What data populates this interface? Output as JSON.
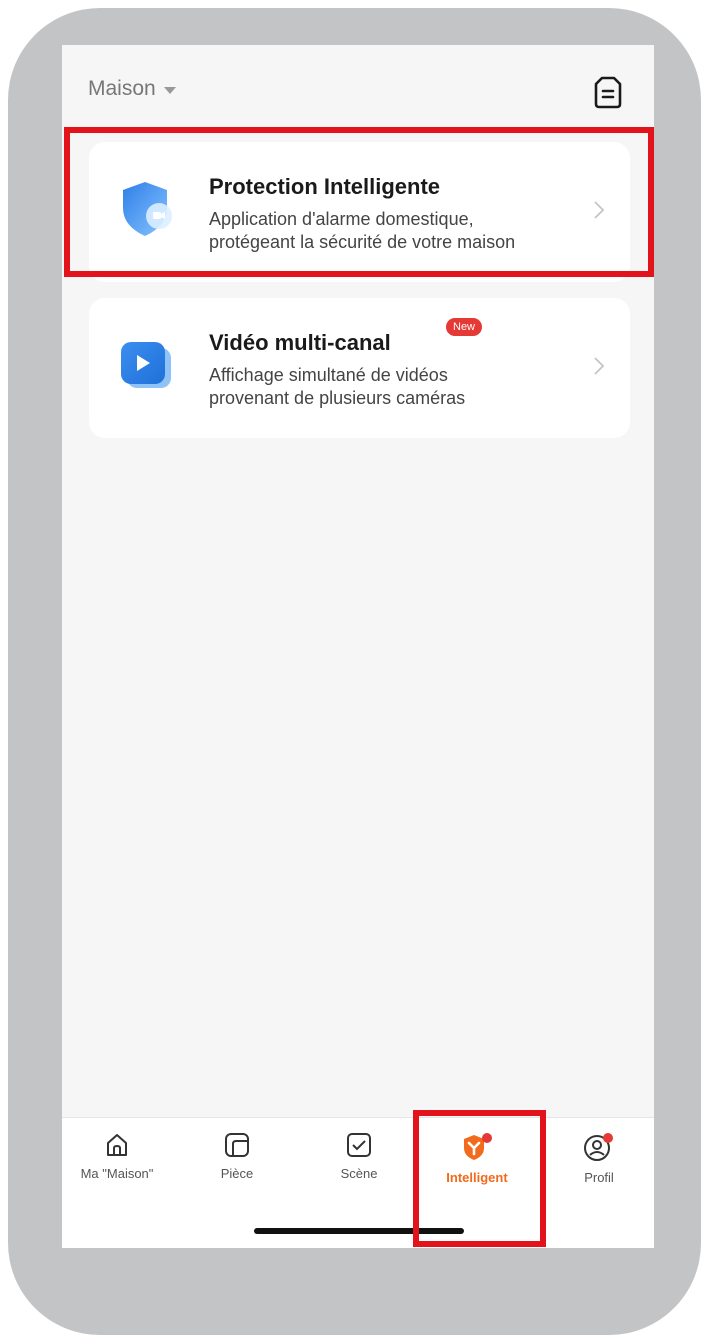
{
  "header": {
    "home_label": "Maison"
  },
  "cards": [
    {
      "title": "Protection Intelligente",
      "description_line1": "Application d'alarme domestique,",
      "description_line2": "protégeant la sécurité de votre maison",
      "icon": "shield-camera-icon"
    },
    {
      "title": "Vidéo multi-canal",
      "badge": "New",
      "description_line1": "Affichage simultané de vidéos",
      "description_line2": "provenant de plusieurs caméras",
      "icon": "video-play-icon"
    }
  ],
  "tabs": [
    {
      "label": "Ma \"Maison\"",
      "icon": "home-icon"
    },
    {
      "label": "Pièce",
      "icon": "room-icon"
    },
    {
      "label": "Scène",
      "icon": "scene-check-icon"
    },
    {
      "label": "Intelligent",
      "icon": "intelligent-icon",
      "active": true,
      "notification_dot": true
    },
    {
      "label": "Profil",
      "icon": "profile-icon",
      "notification_dot": true
    }
  ],
  "colors": {
    "accent": "#f26a1b",
    "highlight": "#e3131b",
    "badge": "#e53935",
    "notification": "#e53935",
    "frame": "#c3c4c6"
  }
}
